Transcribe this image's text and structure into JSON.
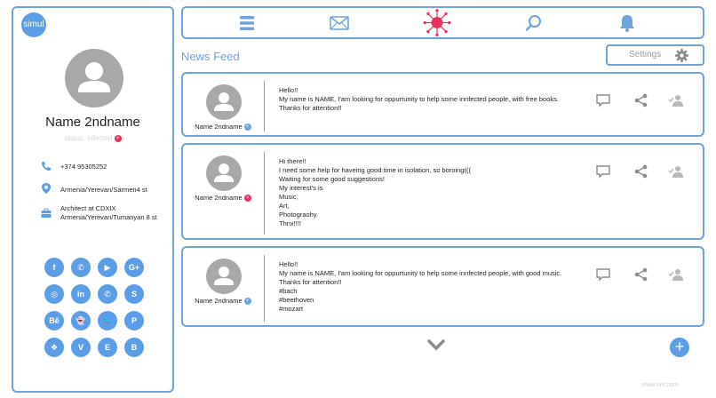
{
  "profile": {
    "logo": "simul",
    "name": "Name 2ndname",
    "status": "status: infected",
    "status_badge": "×",
    "phone": "+374 95305252",
    "address": "Armenia/Yerevan/Sarmen4 st",
    "job_line1": "Architect at CDXIX",
    "job_line2": "Armenia/Yerevan/Tumanyan 8 st",
    "socials": [
      {
        "name": "facebook",
        "glyph": "f"
      },
      {
        "name": "whatsapp",
        "glyph": "✆"
      },
      {
        "name": "youtube",
        "glyph": "▶"
      },
      {
        "name": "google-plus",
        "glyph": "G+"
      },
      {
        "name": "instagram",
        "glyph": "◎"
      },
      {
        "name": "linkedin",
        "glyph": "in"
      },
      {
        "name": "whatsapp",
        "glyph": "✆"
      },
      {
        "name": "skype",
        "glyph": "S"
      },
      {
        "name": "behance",
        "glyph": "Bē"
      },
      {
        "name": "snapchat",
        "glyph": "👻"
      },
      {
        "name": "twitter",
        "glyph": "🐦"
      },
      {
        "name": "pinterest",
        "glyph": "P"
      },
      {
        "name": "dropbox",
        "glyph": "❖"
      },
      {
        "name": "vimeo",
        "glyph": "V"
      },
      {
        "name": "evernote",
        "glyph": "E"
      },
      {
        "name": "blogger",
        "glyph": "B"
      }
    ]
  },
  "nav": {
    "icons": [
      "menu-icon",
      "mail-icon",
      "virus-icon",
      "search-icon",
      "bell-icon"
    ]
  },
  "feed": {
    "title": "News Feed",
    "settings_label": "Settings"
  },
  "posts": [
    {
      "author": "Name 2ndname",
      "badge": "+",
      "badge_color": "blue",
      "lines": [
        "Hello!!",
        "My name is NAME, I'am looking for oppurtunity to help some innfected people, with free books.",
        "Thanks for attention!!"
      ]
    },
    {
      "author": "Name 2ndname",
      "badge": "×",
      "badge_color": "red",
      "lines": [
        "Hi there!!",
        "I need some help for haveing good time in isolation, so boroing(((",
        "Waiting for some good suggestions!",
        "My interest's is",
        "Music,",
        "Art,",
        "Photograohy.",
        "Thnx!!!!"
      ]
    },
    {
      "author": "Name 2ndname",
      "badge": "+",
      "badge_color": "blue",
      "lines": [
        "Hello!!",
        "My name is NAME, I'am looking for oppurtunity to help some innfected people, with good music.",
        "Thanks for attention!!",
        "#bach",
        "#beethoven",
        "#mozart"
      ]
    }
  ],
  "footer": {
    "add_label": "+",
    "watermark": "www.net.com"
  },
  "colors": {
    "accent": "#6fa3dd",
    "social": "#5b9de6",
    "virus": "#e7305f",
    "avatar": "#a8a8a8"
  }
}
